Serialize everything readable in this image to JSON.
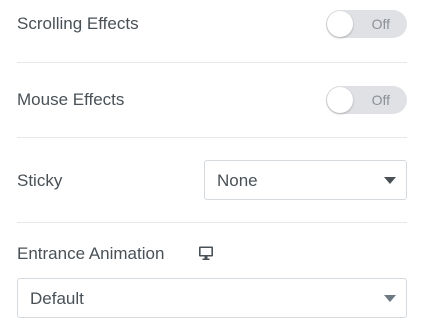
{
  "controls": {
    "scrolling_effects": {
      "label": "Scrolling Effects",
      "state": "Off"
    },
    "mouse_effects": {
      "label": "Mouse Effects",
      "state": "Off"
    },
    "sticky": {
      "label": "Sticky",
      "value": "None"
    },
    "entrance_animation": {
      "label": "Entrance Animation",
      "value": "Default",
      "icon": "monitor-icon"
    }
  }
}
